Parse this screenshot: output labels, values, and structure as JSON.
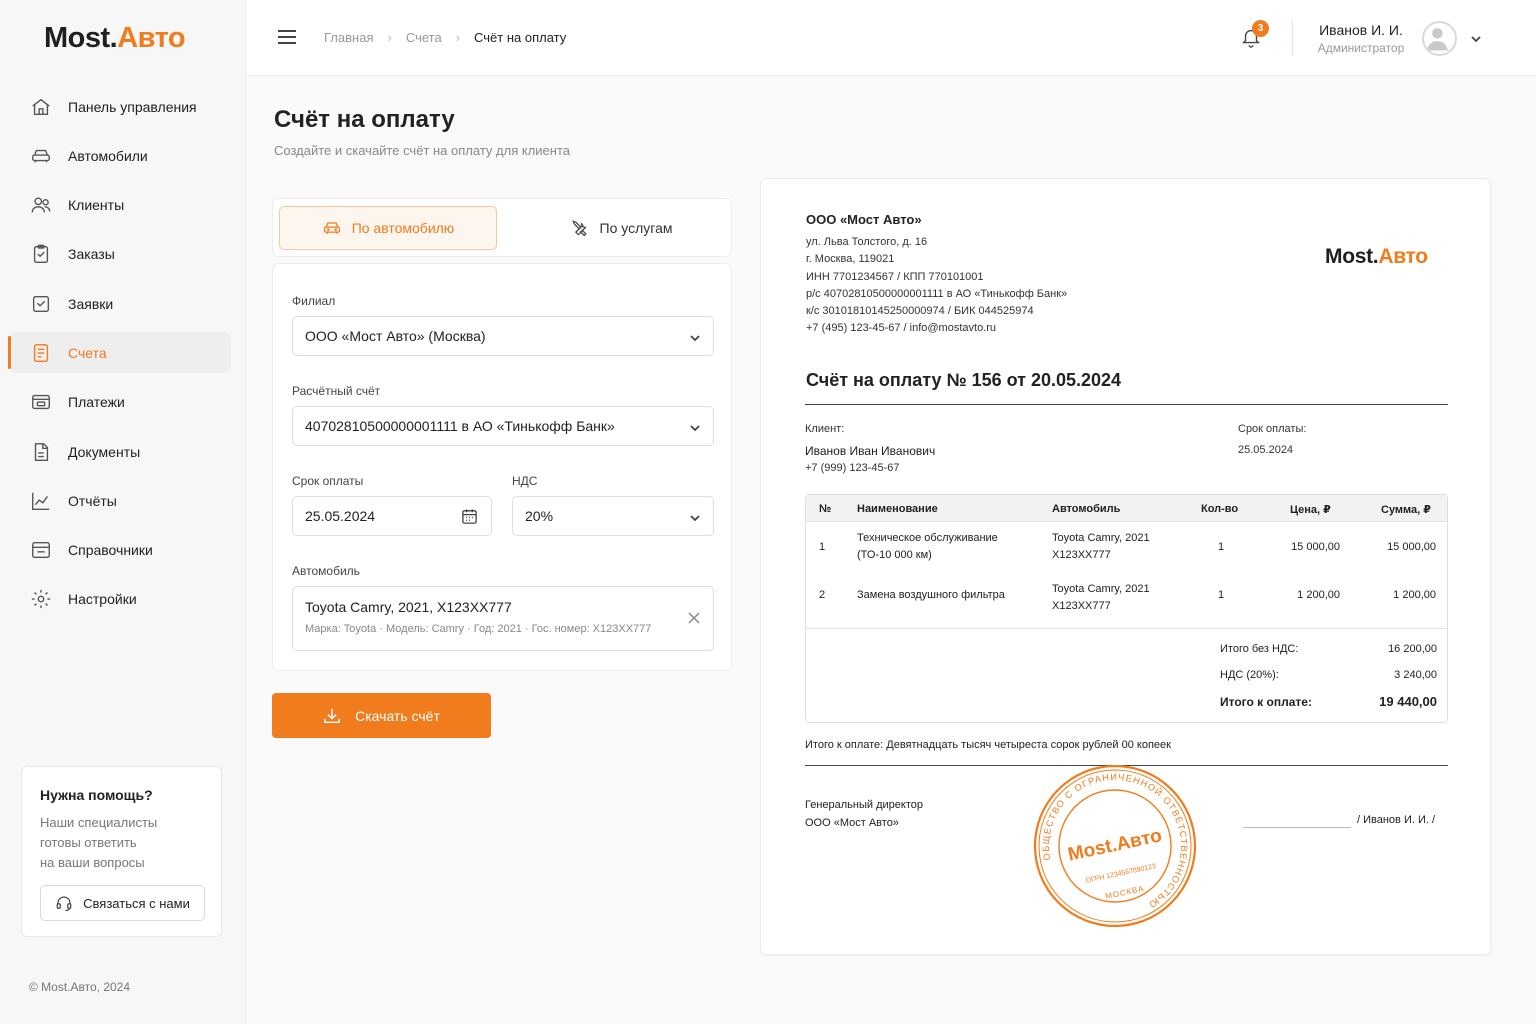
{
  "brand": {
    "part1": "Most.",
    "part2": "Авто",
    "accent": "#f07c1d"
  },
  "sidebar": {
    "items": [
      {
        "label": "Панель управления",
        "icon": "home-icon"
      },
      {
        "label": "Автомобили",
        "icon": "car-icon"
      },
      {
        "label": "Клиенты",
        "icon": "users-icon"
      },
      {
        "label": "Заказы",
        "icon": "clipboard-icon"
      },
      {
        "label": "Заявки",
        "icon": "clipboard-check-icon"
      },
      {
        "label": "Счета",
        "icon": "invoice-icon",
        "active": true
      },
      {
        "label": "Платежи",
        "icon": "wallet-icon"
      },
      {
        "label": "Документы",
        "icon": "document-icon"
      },
      {
        "label": "Отчёты",
        "icon": "chart-icon"
      },
      {
        "label": "Справочники",
        "icon": "directory-icon"
      },
      {
        "label": "Настройки",
        "icon": "gear-icon"
      }
    ],
    "help": {
      "title": "Нужна помощь?",
      "text": "Наши специалисты\nготовы ответить\nна ваши вопросы",
      "button": "Связаться с нами"
    },
    "copyright": "© Most.Авто, 2024"
  },
  "header": {
    "breadcrumbs": [
      "Главная",
      "Счета",
      "Счёт на оплату"
    ],
    "notifications": "3",
    "user_name": "Иванов И. И.",
    "user_role": "Администратор"
  },
  "main": {
    "title": "Счёт на оплату",
    "subtitle": "Создайте и скачайте счёт на оплату для клиента",
    "tabs": [
      {
        "label": "По автомобилю",
        "active": true
      },
      {
        "label": "По услугам",
        "active": false
      }
    ],
    "form": {
      "branch_label": "Филиал",
      "branch_value": "ООО «Мост Авто» (Москва)",
      "account_label": "Расчётный счёт",
      "account_value": "40702810500000001111 в АО «Тинькофф Банк»",
      "due_label": "Срок оплаты",
      "due_value": "25.05.2024",
      "vat_label": "НДС",
      "vat_value": "20%",
      "car_label": "Автомобиль",
      "car_value": "Toyota Camry, 2021, Х123ХХ777",
      "car_details": "Марка: Toyota · Модель: Camry · Год: 2021 · Гос. номер: Х123ХХ777"
    },
    "download_button": "Скачать счёт"
  },
  "invoice": {
    "company": "ООО «Мост Авто»",
    "company_lines": [
      "ул. Льва Толстого, д. 16",
      "г. Москва, 119021",
      "ИНН 7701234567 / КПП 770101001",
      "р/с 40702810500000001111 в АО «Тинькофф Банк»",
      "к/с 30101810145250000974 / БИК 044525974",
      "+7 (495) 123-45-67 / info@mostavto.ru"
    ],
    "title": "Счёт на оплату № 156 от 20.05.2024",
    "client_label": "Клиент:",
    "client_name": "Иванов Иван Иванович",
    "client_phone": "+7 (999) 123-45-67",
    "due_label": "Срок оплаты:",
    "due_value": "25.05.2024",
    "columns": [
      "№",
      "Наименование",
      "Автомобиль",
      "Кол-во",
      "Цена, ₽",
      "Сумма, ₽"
    ],
    "rows": [
      {
        "n": "1",
        "name": "Техническое обслуживание\n(ТО-10 000 км)",
        "car": "Toyota Camry, 2021\nХ123ХХ777",
        "qty": "1",
        "price": "15 000,00",
        "sum": "15 000,00"
      },
      {
        "n": "2",
        "name": "Замена воздушного фильтра",
        "car": "Toyota Camry, 2021\nХ123ХХ777",
        "qty": "1",
        "price": "1 200,00",
        "sum": "1 200,00"
      }
    ],
    "totals": [
      {
        "label": "Итого без НДС:",
        "value": "16 200,00"
      },
      {
        "label": "НДС (20%):",
        "value": "3 240,00"
      },
      {
        "label": "Итого к оплате:",
        "value": "19 440,00",
        "bold": true
      }
    ],
    "amount_words": "Итого к оплате: Девятнадцать тысяч четыреста сорок рублей 00 копеек",
    "signer_role": "Генеральный директор",
    "signer_company": "ООО «Мост Авто»",
    "signer_name": "/ Иванов И. И. /",
    "stamp": {
      "ring_text": "ОБЩЕСТВО С ОГРАНИЧЕННОЙ ОТВЕТСТВЕННОСТЬЮ",
      "center": "Most.Авто",
      "ogrn": "ОГРН 1234567890123",
      "city": "МОСКВА"
    }
  }
}
